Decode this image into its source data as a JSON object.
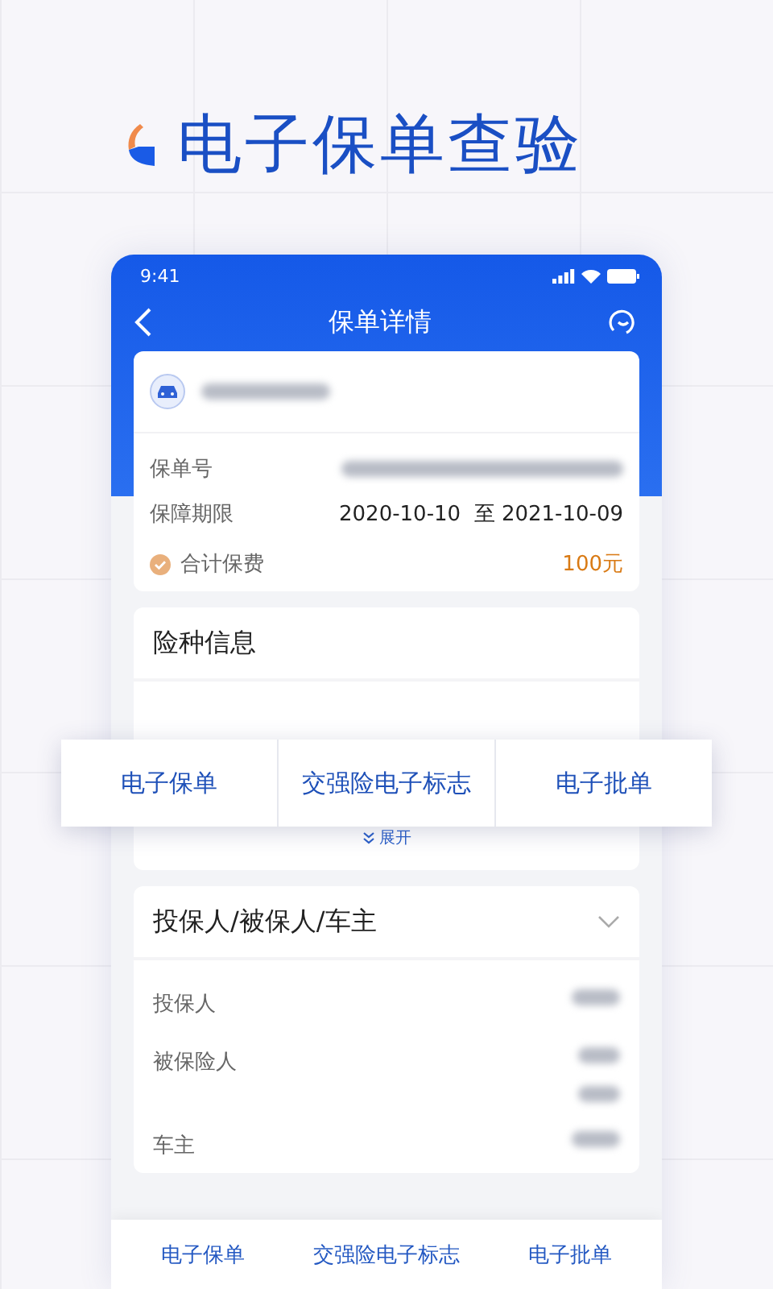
{
  "promo": {
    "title": "电子保单查验"
  },
  "status_bar": {
    "time": "9:41"
  },
  "nav": {
    "title": "保单详情"
  },
  "policy_card": {
    "fields": [
      {
        "label": "保单号",
        "kind": "blurred"
      },
      {
        "label": "保障期限",
        "kind": "text",
        "value": "2020-10-10  至 2021-10-09"
      }
    ],
    "total": {
      "label": "合计保费",
      "value": "100元"
    }
  },
  "coverage": {
    "title": "险种信息",
    "expand": "展开"
  },
  "floating_menu": [
    "电子保单",
    "交强险电子标志",
    "电子批单"
  ],
  "parties": {
    "title": "投保人/被保人/车主",
    "rows": [
      {
        "label": "投保人",
        "kind": "single"
      },
      {
        "label": "被保险人",
        "kind": "double"
      },
      {
        "label": "车主",
        "kind": "single"
      }
    ]
  },
  "bottom_bar": [
    "电子保单",
    "交强险电子标志",
    "电子批单"
  ]
}
